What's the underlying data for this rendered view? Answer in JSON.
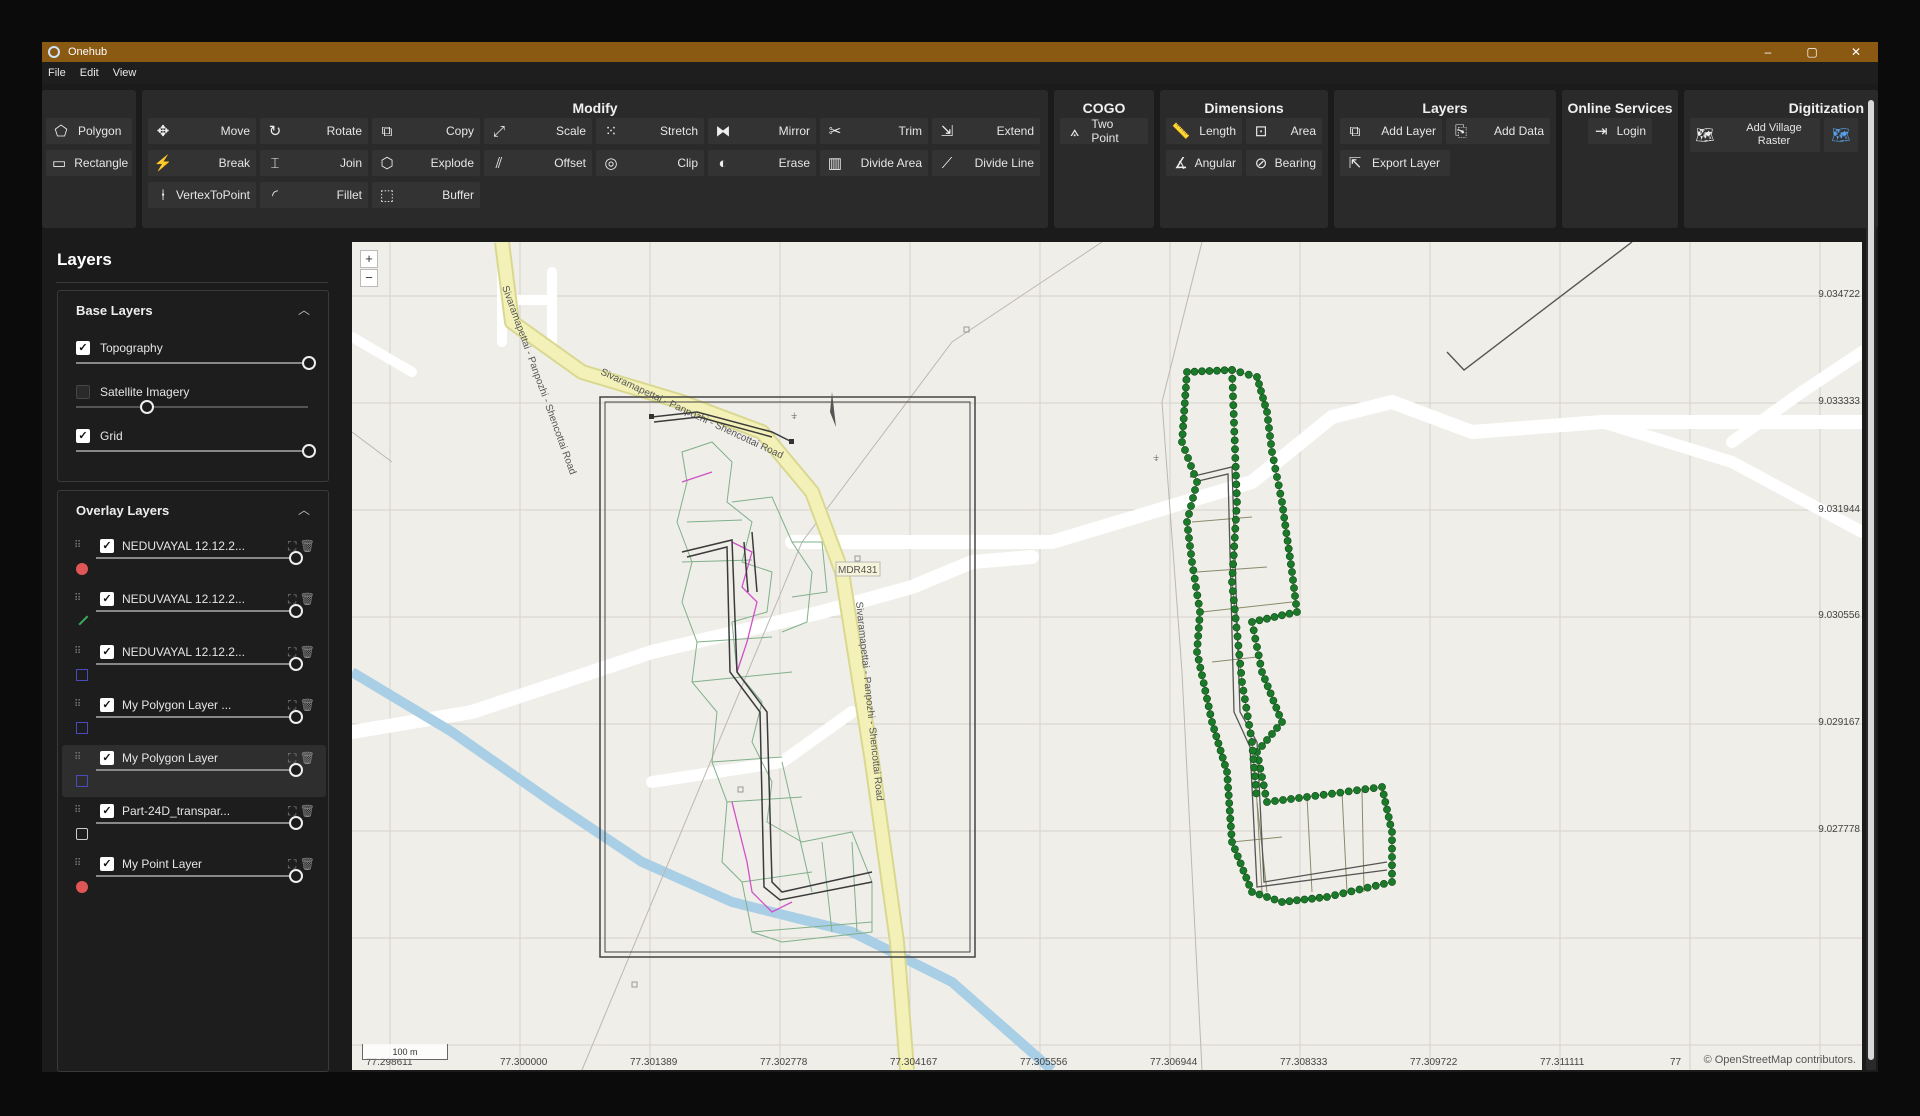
{
  "window": {
    "title": "Onehub",
    "controls": [
      "–",
      "▢",
      "✕"
    ]
  },
  "menu": [
    "File",
    "Edit",
    "View"
  ],
  "ribbon": {
    "shapes": {
      "polygon": "Polygon",
      "rectangle": "Rectangle"
    },
    "modify": {
      "title": "Modify",
      "row1": [
        "Move",
        "Rotate",
        "Copy",
        "Scale",
        "Stretch",
        "Mirror",
        "Trim",
        "Extend"
      ],
      "row2": [
        "Break",
        "Join",
        "Explode",
        "Offset",
        "Clip",
        "Erase",
        "Divide Area",
        "Divide Line"
      ],
      "row3": [
        "VertexToPoint",
        "Fillet",
        "Buffer"
      ]
    },
    "cogo": {
      "title": "COGO",
      "two_point": "Two Point"
    },
    "dimensions": {
      "title": "Dimensions",
      "length": "Length",
      "area": "Area",
      "angular": "Angular",
      "bearing": "Bearing"
    },
    "layers": {
      "title": "Layers",
      "add_layer": "Add Layer",
      "add_data": "Add Data",
      "export_layer": "Export Layer"
    },
    "online": {
      "title": "Online Services",
      "login": "Login"
    },
    "digitization": {
      "title": "Digitization",
      "add_village_raster": "Add Village Raster"
    }
  },
  "sidebar": {
    "title": "Layers",
    "base": {
      "title": "Base Layers",
      "items": [
        {
          "label": "Topography",
          "checked": true,
          "opacity": 1.0
        },
        {
          "label": "Satellite Imagery",
          "checked": false,
          "opacity": 0.3
        },
        {
          "label": "Grid",
          "checked": true,
          "opacity": 1.0
        }
      ]
    },
    "overlay": {
      "title": "Overlay Layers",
      "items": [
        {
          "label": "NEDUVAYAL 12.12.2...",
          "symbol": "point",
          "color": "#e05555",
          "opacity": 1.0
        },
        {
          "label": "NEDUVAYAL 12.12.2...",
          "symbol": "line",
          "color": "#3cab5a",
          "opacity": 1.0
        },
        {
          "label": "NEDUVAYAL 12.12.2...",
          "symbol": "polygon",
          "color": "#4b4bbd",
          "opacity": 1.0
        },
        {
          "label": "My Polygon Layer ...",
          "symbol": "polygon",
          "color": "#4b4bbd",
          "opacity": 1.0
        },
        {
          "label": "My Polygon Layer",
          "symbol": "polygon",
          "color": "#4b4bbd",
          "opacity": 1.0,
          "selected": true
        },
        {
          "label": "Part-24D_transpar...",
          "symbol": "raster",
          "color": "#cccccc",
          "opacity": 1.0
        },
        {
          "label": "My Point Layer",
          "symbol": "point",
          "color": "#e05555",
          "opacity": 1.0
        }
      ]
    }
  },
  "map": {
    "zoom_in": "+",
    "zoom_out": "−",
    "y_ticks": [
      "9.034722",
      "9.033333",
      "9.031944",
      "9.030556",
      "9.029167",
      "9.027778"
    ],
    "x_ticks": [
      "77.298611",
      "77.300000",
      "77.301389",
      "77.302778",
      "77.304167",
      "77.305556",
      "77.306944",
      "77.308333",
      "77.309722",
      "77.311111",
      "77"
    ],
    "road_labels": [
      "Sivaramapettai - Panpozhi - Shencottai Road",
      "Sivaramapettai - Panpozhi - Shencottai Road",
      "MDR431"
    ],
    "scale": "100 m",
    "attribution": "© OpenStreetMap contributors."
  }
}
